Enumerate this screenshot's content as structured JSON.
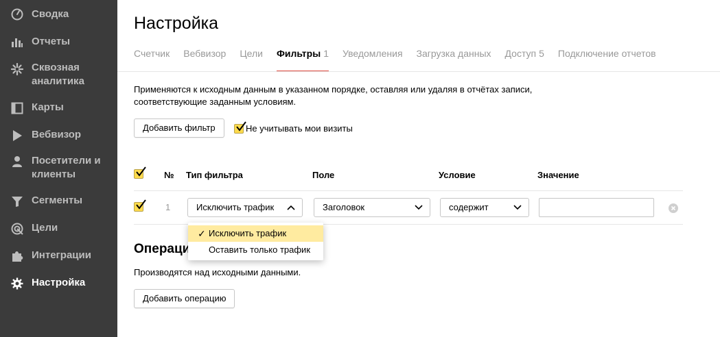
{
  "sidebar": {
    "items": [
      {
        "label": "Сводка",
        "icon": "dashboard-icon"
      },
      {
        "label": "Отчеты",
        "icon": "bar-chart-icon"
      },
      {
        "label": "Сквозная аналитика",
        "icon": "sparkle-icon"
      },
      {
        "label": "Карты",
        "icon": "map-icon"
      },
      {
        "label": "Вебвизор",
        "icon": "play-icon"
      },
      {
        "label": "Посетители и клиенты",
        "icon": "person-icon"
      },
      {
        "label": "Сегменты",
        "icon": "funnel-icon"
      },
      {
        "label": "Цели",
        "icon": "target-icon"
      },
      {
        "label": "Интеграции",
        "icon": "puzzle-icon"
      },
      {
        "label": "Настройка",
        "icon": "gear-icon",
        "active": true
      }
    ]
  },
  "page": {
    "title": "Настройка"
  },
  "tabs": [
    {
      "label": "Счетчик"
    },
    {
      "label": "Вебвизор"
    },
    {
      "label": "Цели"
    },
    {
      "label": "Фильтры",
      "count": "1",
      "active": true
    },
    {
      "label": "Уведомления"
    },
    {
      "label": "Загрузка данных"
    },
    {
      "label": "Доступ",
      "count": "5"
    },
    {
      "label": "Подключение отчетов"
    }
  ],
  "filters": {
    "description_line1": "Применяются к исходным данным в указанном порядке, оставляя или удаляя в отчётах записи,",
    "description_line2": "соответствующие заданным условиям.",
    "add_button": "Добавить фильтр",
    "ignore_my_visits": "Не учитывать мои визиты",
    "columns": {
      "number": "№",
      "filter_type": "Тип фильтра",
      "field": "Поле",
      "condition": "Условие",
      "value": "Значение"
    },
    "rows": [
      {
        "number": "1",
        "filter_type": "Исключить трафик",
        "field": "Заголовок",
        "condition": "содержит",
        "value": ""
      }
    ],
    "dropdown_options": [
      {
        "label": "Исключить трафик",
        "selected": true
      },
      {
        "label": "Оставить только трафик",
        "selected": false
      }
    ]
  },
  "operations": {
    "title": "Операции",
    "description": "Производятся над исходными данными.",
    "add_button": "Добавить операцию"
  },
  "colors": {
    "sidebar_bg": "#3b3b3b",
    "accent_red": "#e0483e",
    "checkbox_yellow": "#ffdb4d",
    "selected_option": "#ffeba0"
  }
}
